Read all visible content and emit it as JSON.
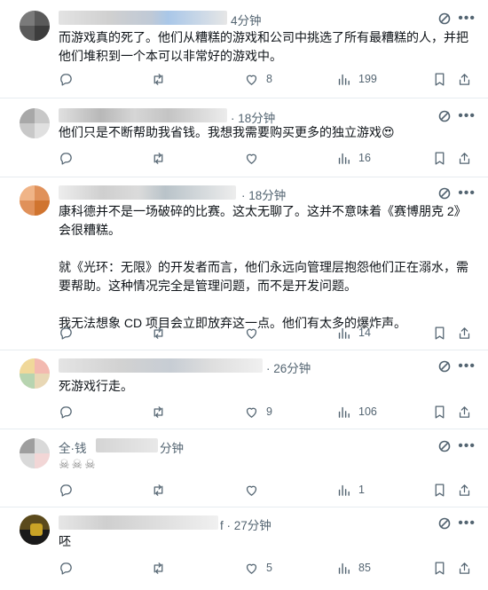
{
  "tweets": [
    {
      "time": "4分钟",
      "text": "而游戏真的死了。他们从糟糕的游戏和公司中挑选了所有最糟糕的人，并把他们堆积到一个本可以非常好的游戏中。",
      "reply_count": "",
      "repost_count": "",
      "like_count": "8",
      "view_count": "199"
    },
    {
      "time": "· 18分钟",
      "text": "他们只是不断帮助我省钱。我想我需要购买更多的独立游戏😍",
      "reply_count": "",
      "repost_count": "",
      "like_count": "",
      "view_count": "16"
    },
    {
      "time": "· 18分钟",
      "text": "康科德并不是一场破碎的比赛。这太无聊了。这并不意味着《赛博朋克 2》会很糟糕。\n\n就《光环：无限》的开发者而言，他们永远向管理层抱怨他们正在溺水，需要帮助。这种情况完全是管理问题，而不是开发问题。\n\n我无法想象 CD 项目会立即放弃这一点。他们有太多的爆炸声。",
      "reply_count": "",
      "repost_count": "",
      "like_count": "",
      "view_count": "14"
    },
    {
      "time": "· 26分钟",
      "text": "死游戏行走。",
      "reply_count": "",
      "repost_count": "",
      "like_count": "9",
      "view_count": "106"
    },
    {
      "name_partial": "全·钱",
      "time": "分钟",
      "text": "☠☠☠",
      "reply_count": "",
      "repost_count": "",
      "like_count": "",
      "view_count": "1"
    },
    {
      "time": "f · 27分钟",
      "text": "呸",
      "reply_count": "",
      "repost_count": "",
      "like_count": "5",
      "view_count": "85"
    }
  ],
  "icons": {
    "reply": "reply-icon",
    "repost": "repost-icon",
    "like": "like-icon",
    "views": "views-icon",
    "bookmark": "bookmark-icon",
    "share": "share-icon",
    "grok": "grok-icon",
    "more": "more-icon"
  },
  "colors": {
    "text": "#0f1419",
    "muted": "#536471",
    "divider": "#e6ecf0"
  }
}
